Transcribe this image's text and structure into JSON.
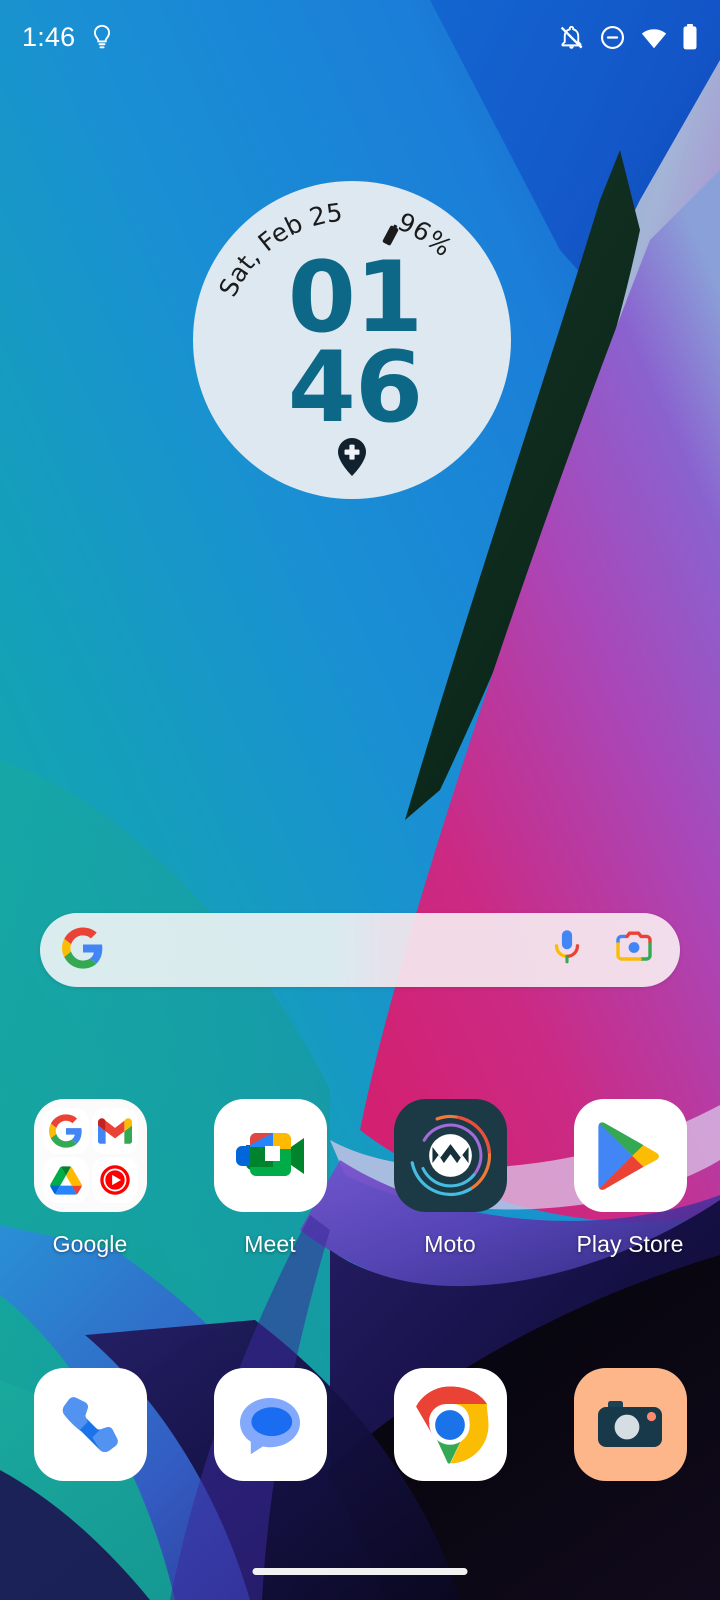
{
  "status_bar": {
    "time": "1:46",
    "left_icons": [
      {
        "name": "lightbulb-icon",
        "glyph": "bulb"
      }
    ],
    "right_icons": [
      {
        "name": "notifications-silenced-icon",
        "glyph": "bell-off"
      },
      {
        "name": "do-not-disturb-icon",
        "glyph": "dnd"
      },
      {
        "name": "wifi-icon",
        "glyph": "wifi"
      },
      {
        "name": "battery-icon",
        "glyph": "battery-full"
      }
    ]
  },
  "clock_widget": {
    "date_text": "Sat, Feb 25",
    "battery_text": "96%",
    "battery_icon": "battery-icon",
    "hour": "01",
    "minute": "46",
    "bottom_icon": "location-pin-plus-icon",
    "face_color": "#dde8f0",
    "digit_color": "#0d6787"
  },
  "search": {
    "leading_icon": "google-g-icon",
    "placeholder": "",
    "value": "",
    "actions": [
      {
        "name": "voice-search-icon",
        "label": "Voice search"
      },
      {
        "name": "google-lens-icon",
        "label": "Google Lens"
      }
    ]
  },
  "apps": [
    {
      "label": "Google",
      "type": "folder",
      "icon_name": "google-folder-icon",
      "contents": [
        "google-g-icon",
        "gmail-icon",
        "google-drive-icon",
        "youtube-music-icon"
      ]
    },
    {
      "label": "Meet",
      "type": "app",
      "icon_name": "google-meet-icon"
    },
    {
      "label": "Moto",
      "type": "app",
      "icon_name": "moto-icon"
    },
    {
      "label": "Play Store",
      "type": "app",
      "icon_name": "google-play-store-icon"
    }
  ],
  "dock": [
    {
      "label": "Phone",
      "icon_name": "phone-icon"
    },
    {
      "label": "Messages",
      "icon_name": "messages-icon"
    },
    {
      "label": "Chrome",
      "icon_name": "chrome-icon"
    },
    {
      "label": "Camera",
      "icon_name": "camera-icon"
    }
  ],
  "navigation": {
    "gesture_bar": "home-gesture-bar"
  },
  "wallpaper": {
    "name": "abstract-ribbons-wallpaper",
    "colors": {
      "teal": "#14a39b",
      "blue": "#1f93d8",
      "deep_blue": "#1151b5",
      "dark_green": "#10301f",
      "magenta": "#c9237a",
      "purple": "#7a4fc0",
      "light_blue_grey": "#9fb8d4",
      "dark_navy": "#0c0a1f",
      "near_black": "#07060f"
    }
  }
}
